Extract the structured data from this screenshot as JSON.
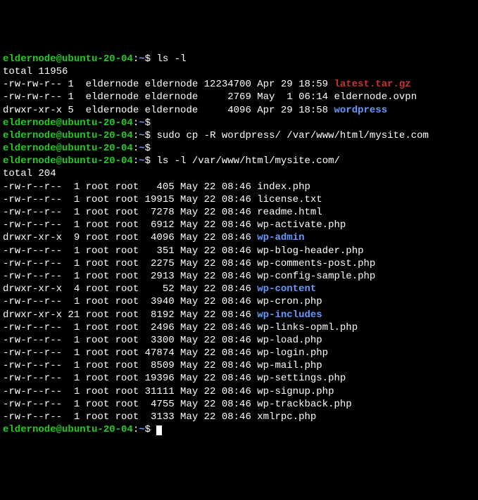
{
  "prompt": {
    "user_host": "eldernode@ubuntu-20-04",
    "sep": ":",
    "path": "~",
    "symbol": "$"
  },
  "commands": {
    "c1": "ls -l",
    "c2": "sudo cp -R wordpress/ /var/www/html/mysite.com",
    "c3": "ls -l /var/www/html/mysite.com/"
  },
  "totals": {
    "t1": "total 11956",
    "t2": "total 204"
  },
  "top_listing": [
    {
      "perm": "-rw-rw-r--",
      "links": "1",
      "user": "eldernode",
      "group": "eldernode",
      "size": "12234700",
      "date": "Apr 29 18:59",
      "name": "latest.tar.gz",
      "class": "red"
    },
    {
      "perm": "-rw-rw-r--",
      "links": "1",
      "user": "eldernode",
      "group": "eldernode",
      "size": "2769",
      "date": "May  1 06:14",
      "name": "eldernode.ovpn",
      "class": "white"
    },
    {
      "perm": "drwxr-xr-x",
      "links": "5",
      "user": "eldernode",
      "group": "eldernode",
      "size": "4096",
      "date": "Apr 29 18:58",
      "name": "wordpress",
      "class": "blue"
    }
  ],
  "bottom_listing": [
    {
      "perm": "-rw-r--r--",
      "links": " 1",
      "user": "root",
      "group": "root",
      "size": "  405",
      "date": "May 22 08:46",
      "name": "index.php",
      "class": "white"
    },
    {
      "perm": "-rw-r--r--",
      "links": " 1",
      "user": "root",
      "group": "root",
      "size": "19915",
      "date": "May 22 08:46",
      "name": "license.txt",
      "class": "white"
    },
    {
      "perm": "-rw-r--r--",
      "links": " 1",
      "user": "root",
      "group": "root",
      "size": " 7278",
      "date": "May 22 08:46",
      "name": "readme.html",
      "class": "white"
    },
    {
      "perm": "-rw-r--r--",
      "links": " 1",
      "user": "root",
      "group": "root",
      "size": " 6912",
      "date": "May 22 08:46",
      "name": "wp-activate.php",
      "class": "white"
    },
    {
      "perm": "drwxr-xr-x",
      "links": " 9",
      "user": "root",
      "group": "root",
      "size": " 4096",
      "date": "May 22 08:46",
      "name": "wp-admin",
      "class": "blue"
    },
    {
      "perm": "-rw-r--r--",
      "links": " 1",
      "user": "root",
      "group": "root",
      "size": "  351",
      "date": "May 22 08:46",
      "name": "wp-blog-header.php",
      "class": "white"
    },
    {
      "perm": "-rw-r--r--",
      "links": " 1",
      "user": "root",
      "group": "root",
      "size": " 2275",
      "date": "May 22 08:46",
      "name": "wp-comments-post.php",
      "class": "white"
    },
    {
      "perm": "-rw-r--r--",
      "links": " 1",
      "user": "root",
      "group": "root",
      "size": " 2913",
      "date": "May 22 08:46",
      "name": "wp-config-sample.php",
      "class": "white"
    },
    {
      "perm": "drwxr-xr-x",
      "links": " 4",
      "user": "root",
      "group": "root",
      "size": "   52",
      "date": "May 22 08:46",
      "name": "wp-content",
      "class": "blue"
    },
    {
      "perm": "-rw-r--r--",
      "links": " 1",
      "user": "root",
      "group": "root",
      "size": " 3940",
      "date": "May 22 08:46",
      "name": "wp-cron.php",
      "class": "white"
    },
    {
      "perm": "drwxr-xr-x",
      "links": "21",
      "user": "root",
      "group": "root",
      "size": " 8192",
      "date": "May 22 08:46",
      "name": "wp-includes",
      "class": "blue"
    },
    {
      "perm": "-rw-r--r--",
      "links": " 1",
      "user": "root",
      "group": "root",
      "size": " 2496",
      "date": "May 22 08:46",
      "name": "wp-links-opml.php",
      "class": "white"
    },
    {
      "perm": "-rw-r--r--",
      "links": " 1",
      "user": "root",
      "group": "root",
      "size": " 3300",
      "date": "May 22 08:46",
      "name": "wp-load.php",
      "class": "white"
    },
    {
      "perm": "-rw-r--r--",
      "links": " 1",
      "user": "root",
      "group": "root",
      "size": "47874",
      "date": "May 22 08:46",
      "name": "wp-login.php",
      "class": "white"
    },
    {
      "perm": "-rw-r--r--",
      "links": " 1",
      "user": "root",
      "group": "root",
      "size": " 8509",
      "date": "May 22 08:46",
      "name": "wp-mail.php",
      "class": "white"
    },
    {
      "perm": "-rw-r--r--",
      "links": " 1",
      "user": "root",
      "group": "root",
      "size": "19396",
      "date": "May 22 08:46",
      "name": "wp-settings.php",
      "class": "white"
    },
    {
      "perm": "-rw-r--r--",
      "links": " 1",
      "user": "root",
      "group": "root",
      "size": "31111",
      "date": "May 22 08:46",
      "name": "wp-signup.php",
      "class": "white"
    },
    {
      "perm": "-rw-r--r--",
      "links": " 1",
      "user": "root",
      "group": "root",
      "size": " 4755",
      "date": "May 22 08:46",
      "name": "wp-trackback.php",
      "class": "white"
    },
    {
      "perm": "-rw-r--r--",
      "links": " 1",
      "user": "root",
      "group": "root",
      "size": " 3133",
      "date": "May 22 08:46",
      "name": "xmlrpc.php",
      "class": "white"
    }
  ]
}
